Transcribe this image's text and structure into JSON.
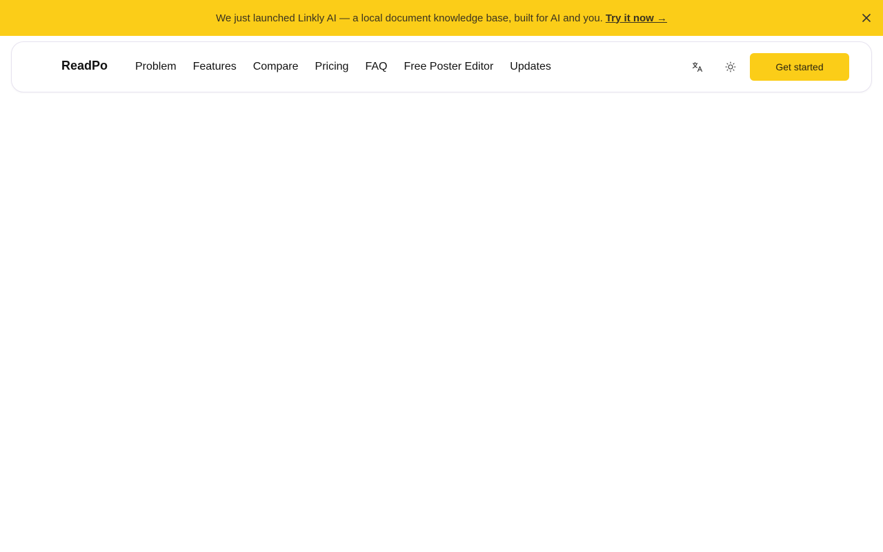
{
  "banner": {
    "message": "We just launched Linkly AI — a local document knowledge base, built for AI and you.",
    "link_label": "Try it now →",
    "close_icon": "close-icon",
    "background": "#fbcd18"
  },
  "navbar": {
    "brand": "ReadPo",
    "links": [
      {
        "label": "Problem"
      },
      {
        "label": "Features"
      },
      {
        "label": "Compare"
      },
      {
        "label": "Pricing"
      },
      {
        "label": "FAQ"
      },
      {
        "label": "Free Poster Editor"
      },
      {
        "label": "Updates"
      }
    ],
    "language_icon": "translate-icon",
    "theme_icon": "sun-icon",
    "cta_label": "Get started",
    "accent": "#fbcd18"
  }
}
